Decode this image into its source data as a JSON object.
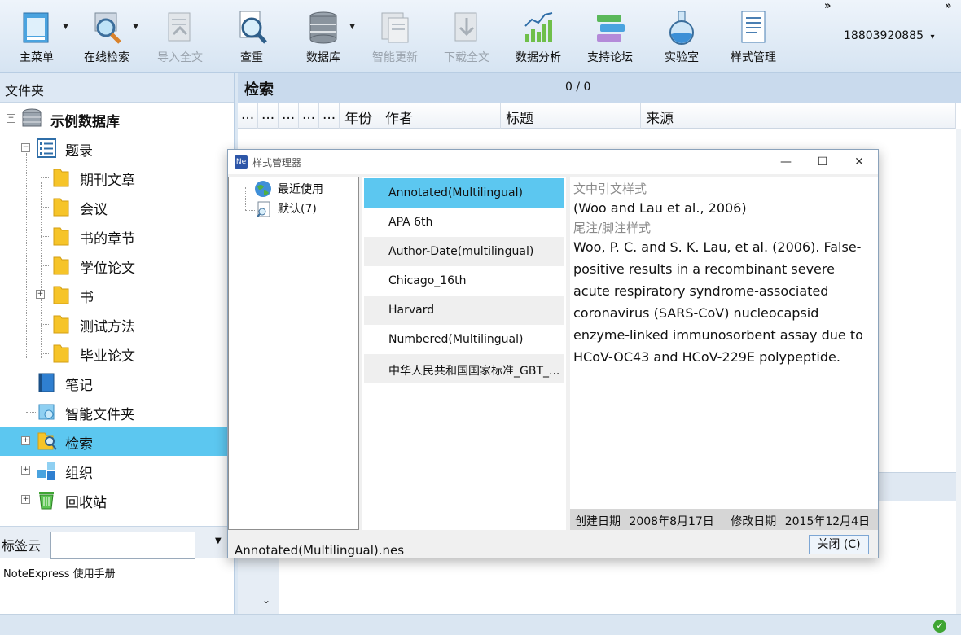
{
  "toolbar": {
    "buttons": [
      {
        "label": "主菜单",
        "icon": "main-menu-icon",
        "enabled": true,
        "dropdown": true
      },
      {
        "label": "在线检索",
        "icon": "online-search-icon",
        "enabled": true,
        "dropdown": true
      },
      {
        "label": "导入全文",
        "icon": "import-fulltext-icon",
        "enabled": false
      },
      {
        "label": "查重",
        "icon": "duplicate-check-icon",
        "enabled": true
      },
      {
        "label": "数据库",
        "icon": "database-icon",
        "enabled": true,
        "dropdown": true
      },
      {
        "label": "智能更新",
        "icon": "smart-update-icon",
        "enabled": false
      },
      {
        "label": "下载全文",
        "icon": "download-fulltext-icon",
        "enabled": false
      },
      {
        "label": "数据分析",
        "icon": "data-analysis-icon",
        "enabled": true
      },
      {
        "label": "支持论坛",
        "icon": "support-forum-icon",
        "enabled": true
      },
      {
        "label": "实验室",
        "icon": "lab-flask-icon",
        "enabled": true
      },
      {
        "label": "样式管理",
        "icon": "style-manager-icon",
        "enabled": true
      }
    ],
    "user": "18803920885",
    "user_caret": "▾",
    "overflow": "»"
  },
  "left": {
    "header": "文件夹",
    "tree": [
      {
        "label": "示例数据库",
        "bold": true,
        "icon": "database-icon",
        "expander": "−"
      },
      {
        "label": "题录",
        "icon": "list-icon",
        "expander": "−"
      },
      {
        "label": "期刊文章",
        "icon": "folder-icon"
      },
      {
        "label": "会议",
        "icon": "folder-icon"
      },
      {
        "label": "书的章节",
        "icon": "folder-icon"
      },
      {
        "label": "学位论文",
        "icon": "folder-icon"
      },
      {
        "label": "书",
        "icon": "folder-icon",
        "expander": "+"
      },
      {
        "label": "测试方法",
        "icon": "folder-icon"
      },
      {
        "label": "毕业论文",
        "icon": "folder-icon"
      },
      {
        "label": "笔记",
        "icon": "notebook-icon"
      },
      {
        "label": "智能文件夹",
        "icon": "smart-folder-icon"
      },
      {
        "label": "检索",
        "icon": "search-folder-icon",
        "expander": "+",
        "selected": true
      },
      {
        "label": "组织",
        "icon": "organize-icon",
        "expander": "+"
      },
      {
        "label": "回收站",
        "icon": "recycle-bin-icon",
        "expander": "+"
      }
    ],
    "tagcloud_label": "标签云",
    "tagcloud_value": "",
    "footer": "NoteExpress  使用手册"
  },
  "search": {
    "title": "检索",
    "count": "0 / 0",
    "columns": [
      "...",
      "...",
      "...",
      "...",
      "...",
      "年份",
      "作者",
      "标题",
      "来源"
    ]
  },
  "dialog": {
    "title": "样式管理器",
    "categories": [
      "最近使用",
      "默认(7)"
    ],
    "styles": [
      "Annotated(Multilingual)",
      "APA 6th",
      "Author-Date(multilingual)",
      "Chicago_16th",
      "Harvard",
      "Numbered(Multilingual)",
      "中华人民共和国国家标准_GBT_..."
    ],
    "selected_style": 0,
    "preview": {
      "intext_heading": "文中引文样式",
      "intext_text": "(Woo and Lau et al., 2006)",
      "note_heading": "尾注/脚注样式",
      "note_text": "Woo, P. C. and S. K. Lau, et al. (2006). False-positive results in a recombinant severe acute respiratory syndrome-associated coronavirus (SARS-CoV) nucleocapsid enzyme-linked immunosorbent assay due to HCoV-OC43 and HCoV-229E polypeptide.",
      "created_label": "创建日期",
      "created_value": "2008年8月17日",
      "modified_label": "修改日期",
      "modified_value": "2015年12月4日"
    },
    "filename": "Annotated(Multilingual).nes",
    "close_label": "关闭 (C)"
  },
  "colors": {
    "selection": "#5cc7f0",
    "header_bg": "#c9daed"
  }
}
